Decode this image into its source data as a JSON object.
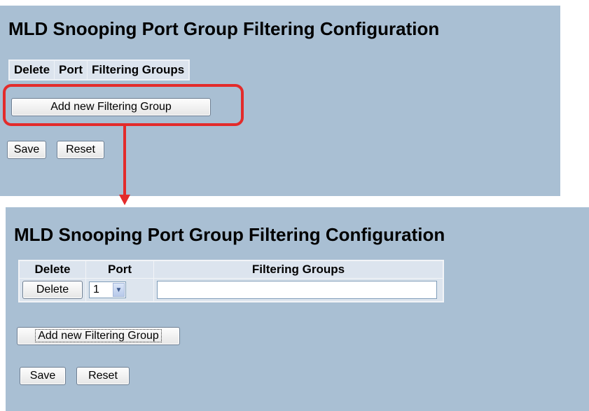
{
  "before": {
    "title": "MLD Snooping Port Group Filtering Configuration",
    "columns": [
      "Delete",
      "Port",
      "Filtering Groups"
    ],
    "add_button": "Add new Filtering Group",
    "save_button": "Save",
    "reset_button": "Reset"
  },
  "after": {
    "title": "MLD Snooping Port Group Filtering Configuration",
    "columns": [
      "Delete",
      "Port",
      "Filtering Groups"
    ],
    "row": {
      "delete_button": "Delete",
      "port_value": "1",
      "filtering_groups_value": ""
    },
    "add_button": "Add new Filtering Group",
    "save_button": "Save",
    "reset_button": "Reset"
  },
  "annotation": {
    "highlight_color": "#e32b2b",
    "panel_color": "#a9bfd3"
  }
}
